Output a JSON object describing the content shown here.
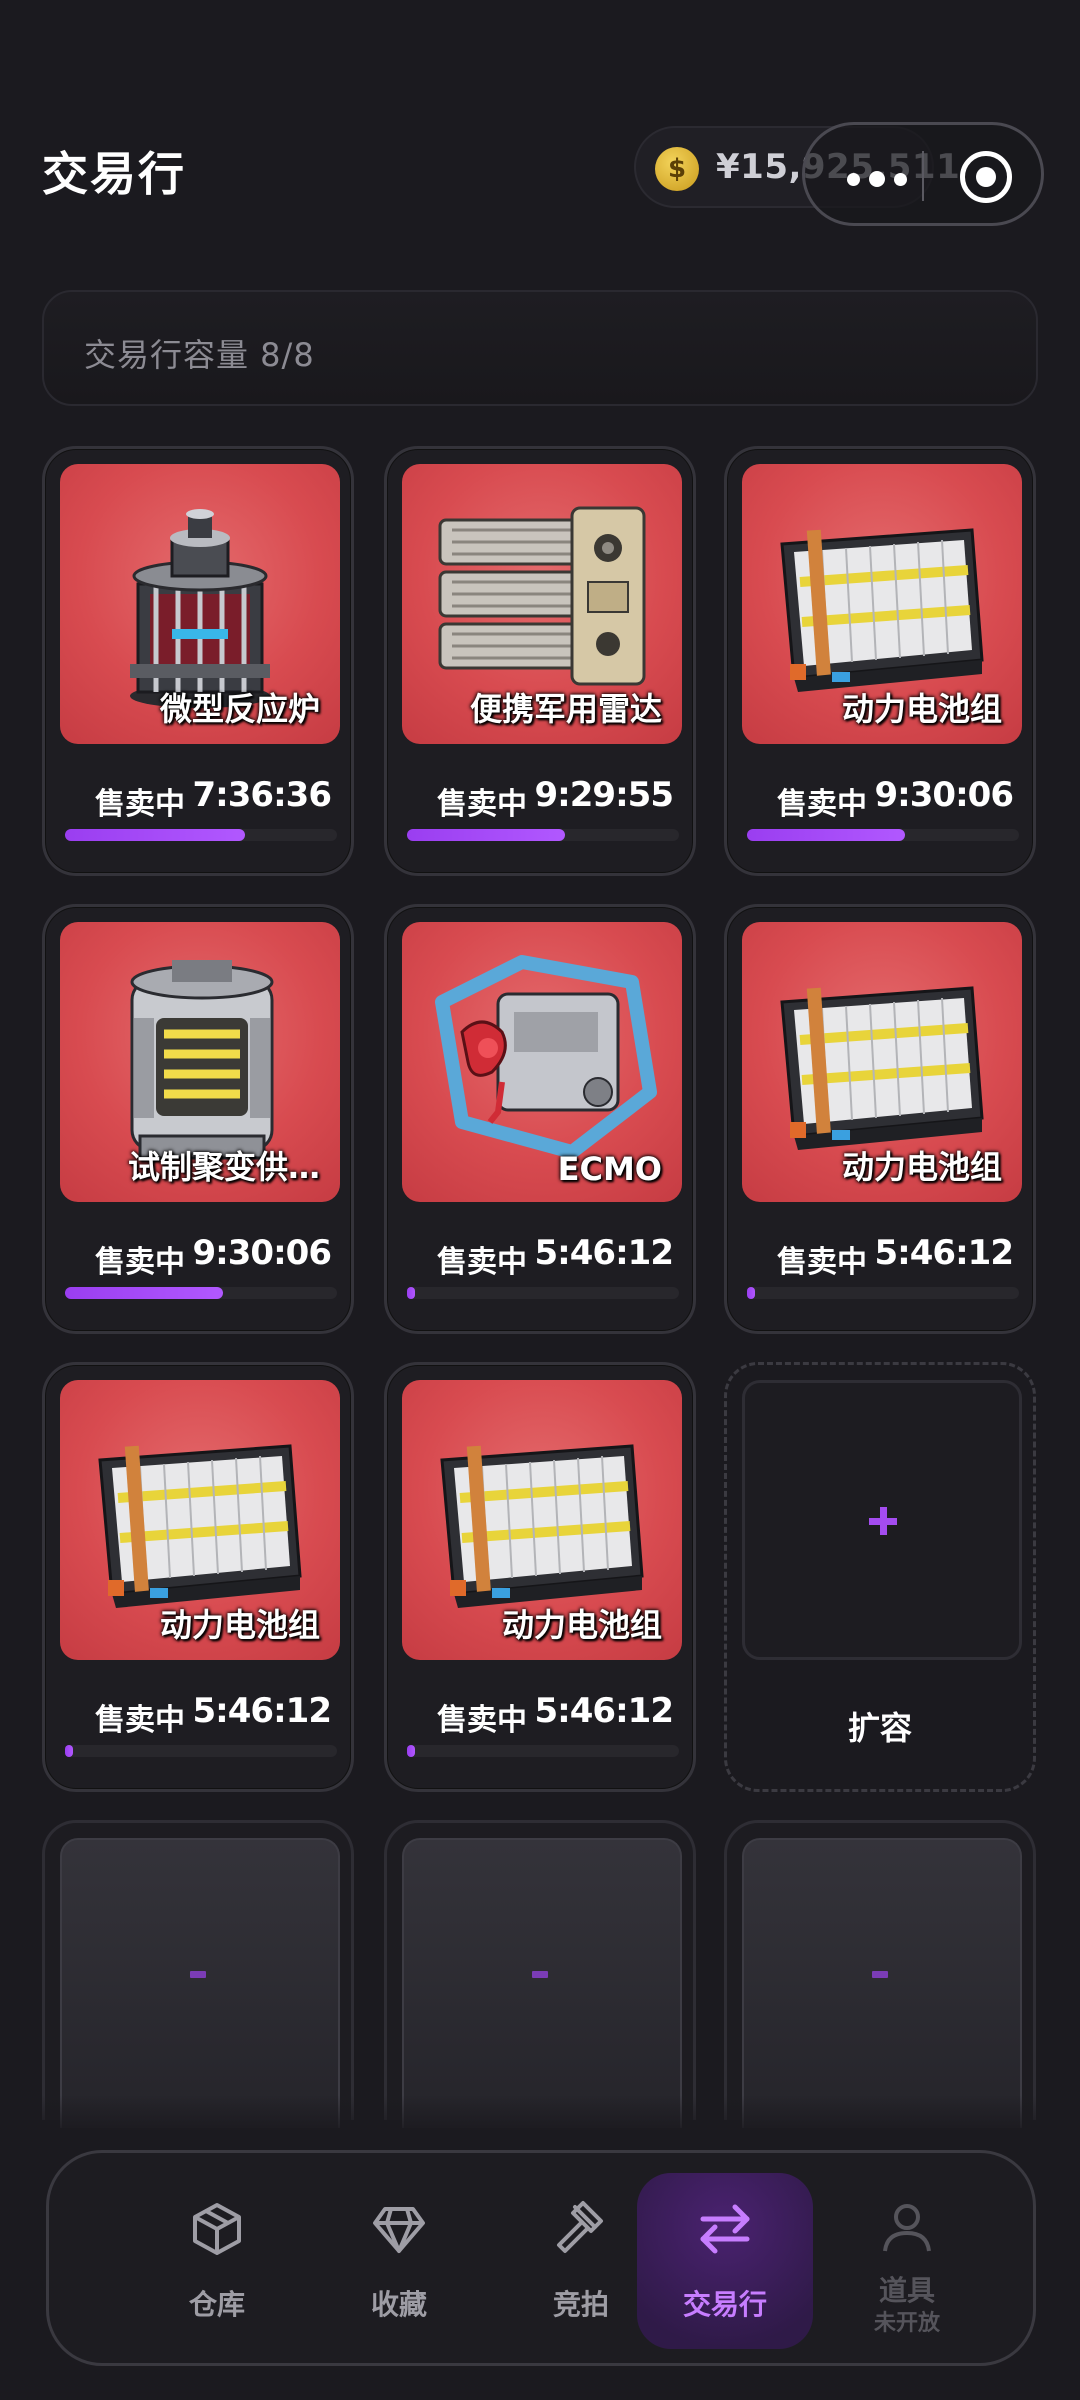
{
  "header": {
    "title": "交易行"
  },
  "balance": {
    "coin_symbol": "$",
    "amount": "¥15,925,511"
  },
  "capacity": {
    "text": "交易行容量 8/8"
  },
  "listings": [
    {
      "name": "微型反应炉",
      "status": "售卖中",
      "timer": "7:36:36",
      "progress": 0.66,
      "icon": "micro-reactor"
    },
    {
      "name": "便携军用雷达",
      "status": "售卖中",
      "timer": "9:29:55",
      "progress": 0.58,
      "icon": "military-radar"
    },
    {
      "name": "动力电池组",
      "status": "售卖中",
      "timer": "9:30:06",
      "progress": 0.58,
      "icon": "battery-pack"
    },
    {
      "name": "试制聚变供…",
      "status": "售卖中",
      "timer": "9:30:06",
      "progress": 0.58,
      "icon": "fusion-core"
    },
    {
      "name": "ECMO",
      "status": "售卖中",
      "timer": "5:46:12",
      "progress": 0.03,
      "icon": "ecmo-machine"
    },
    {
      "name": "动力电池组",
      "status": "售卖中",
      "timer": "5:46:12",
      "progress": 0.03,
      "icon": "battery-pack"
    },
    {
      "name": "动力电池组",
      "status": "售卖中",
      "timer": "5:46:12",
      "progress": 0.03,
      "icon": "battery-pack"
    },
    {
      "name": "动力电池组",
      "status": "售卖中",
      "timer": "5:46:12",
      "progress": 0.03,
      "icon": "battery-pack"
    }
  ],
  "expand": {
    "label": "扩容",
    "icon": "plus-icon"
  },
  "tabs": [
    {
      "label": "仓库",
      "icon": "box-icon",
      "state": "normal"
    },
    {
      "label": "收藏",
      "icon": "diamond-icon",
      "state": "normal"
    },
    {
      "label": "竞拍",
      "icon": "gavel-icon",
      "state": "normal"
    },
    {
      "label": "交易行",
      "icon": "swap-icon",
      "state": "active"
    },
    {
      "label": "道具",
      "sub": "未开放",
      "icon": "person-icon",
      "state": "disabled"
    }
  ],
  "colors": {
    "accent": "#a44cf0",
    "card_red": "#d84b50",
    "background": "#1b1a1f"
  }
}
